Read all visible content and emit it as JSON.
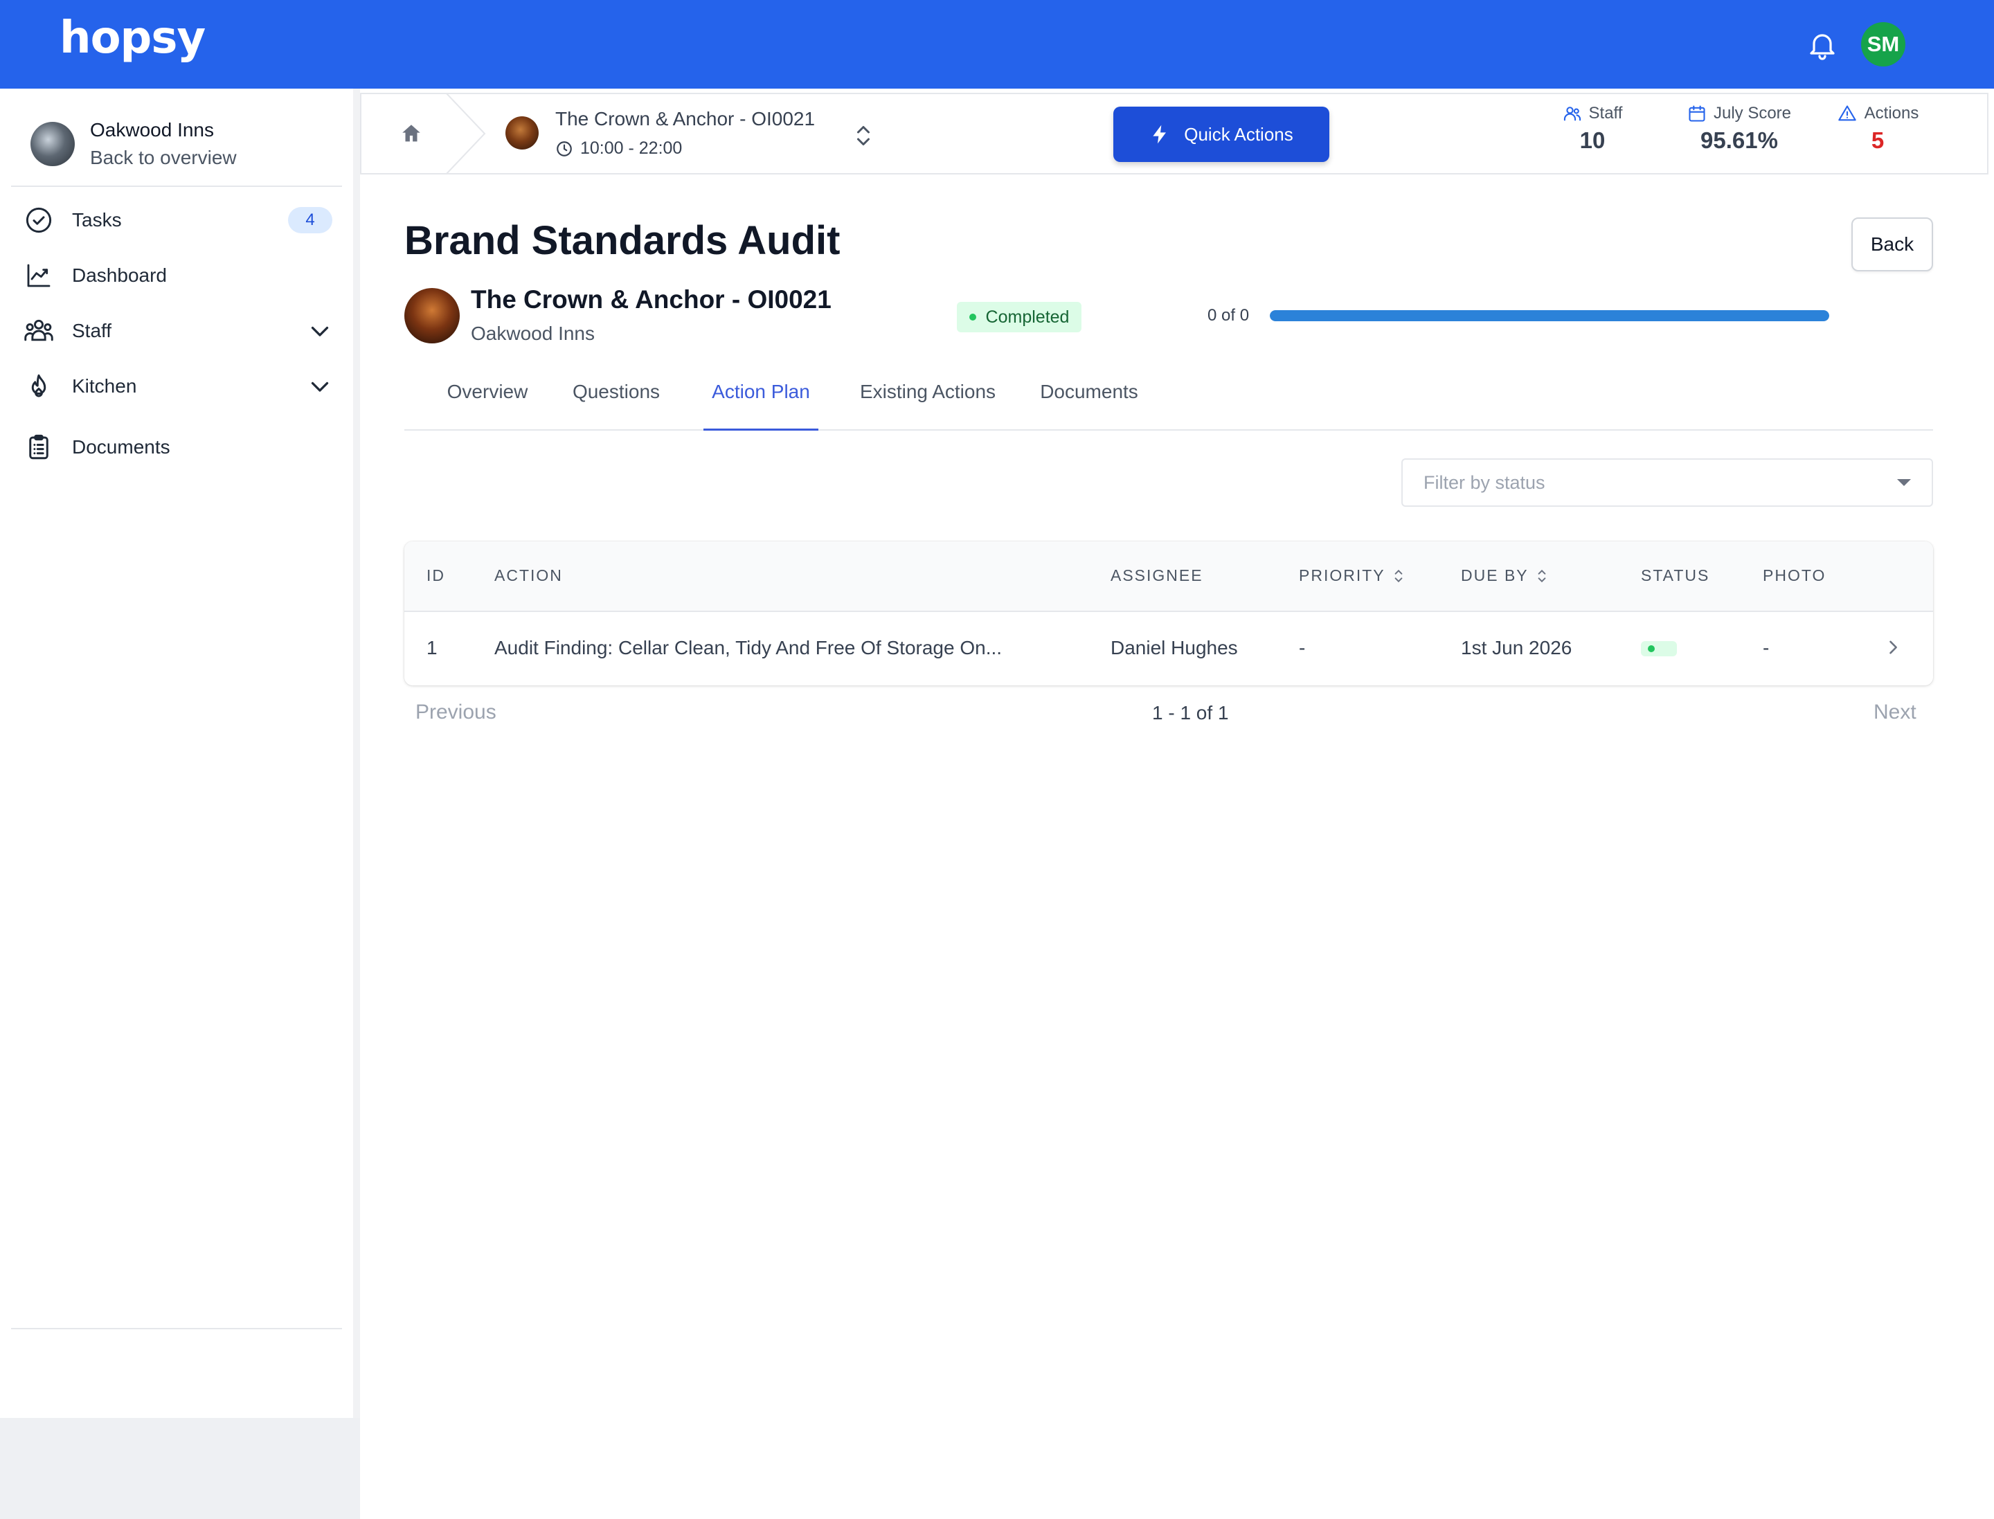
{
  "app": {
    "logo": "hopsy"
  },
  "user": {
    "initials": "SM"
  },
  "sidebar": {
    "org_name": "Oakwood Inns",
    "back_label": "Back to overview",
    "items": [
      {
        "label": "Tasks",
        "icon": "check-circle-icon",
        "badge": "4"
      },
      {
        "label": "Dashboard",
        "icon": "chart-line-icon"
      },
      {
        "label": "Staff",
        "icon": "users-icon"
      },
      {
        "label": "Kitchen",
        "icon": "flame-icon"
      },
      {
        "label": "Documents",
        "icon": "clipboard-icon"
      }
    ]
  },
  "header": {
    "site_name": "The Crown & Anchor - OI0021",
    "site_hours": "10:00 - 22:00",
    "quick_actions": "Quick Actions",
    "stats": [
      {
        "label": "Staff",
        "value": "10",
        "icon": "users-icon"
      },
      {
        "label": "July Score",
        "value": "95.61%",
        "icon": "calendar-icon"
      },
      {
        "label": "Actions",
        "value": "5",
        "icon": "warning-icon",
        "color": "#dc2626"
      }
    ]
  },
  "audit": {
    "title": "Brand Standards Audit",
    "back_label": "Back",
    "location_name": "The Crown & Anchor - OI0021",
    "location_org": "Oakwood Inns",
    "status": "Completed",
    "progress_label": "0 of 0",
    "progress_fraction": 1.0
  },
  "tabs": [
    {
      "label": "Overview",
      "active": false
    },
    {
      "label": "Questions",
      "active": false
    },
    {
      "label": "Action Plan",
      "active": true
    },
    {
      "label": "Existing Actions",
      "active": false
    },
    {
      "label": "Documents",
      "active": false
    }
  ],
  "filter": {
    "placeholder": "Filter by status"
  },
  "table": {
    "headers": [
      "ID",
      "ACTION",
      "ASSIGNEE",
      "PRIORITY",
      "DUE BY",
      "STATUS",
      "PHOTO"
    ],
    "rows": [
      {
        "id": "1",
        "action": "Audit Finding: Cellar Clean, Tidy And Free Of Storage On...",
        "assignee": "Daniel Hughes",
        "priority": "-",
        "due_by": "1st Jun 2026",
        "photo": "-"
      }
    ]
  },
  "pagination": {
    "previous": "Previous",
    "info": "1 - 1 of 1",
    "next": "Next"
  },
  "colors": {
    "brand": "#2563eb",
    "accent": "#1d4ed8",
    "success": "#22c55e",
    "danger": "#dc2626"
  }
}
